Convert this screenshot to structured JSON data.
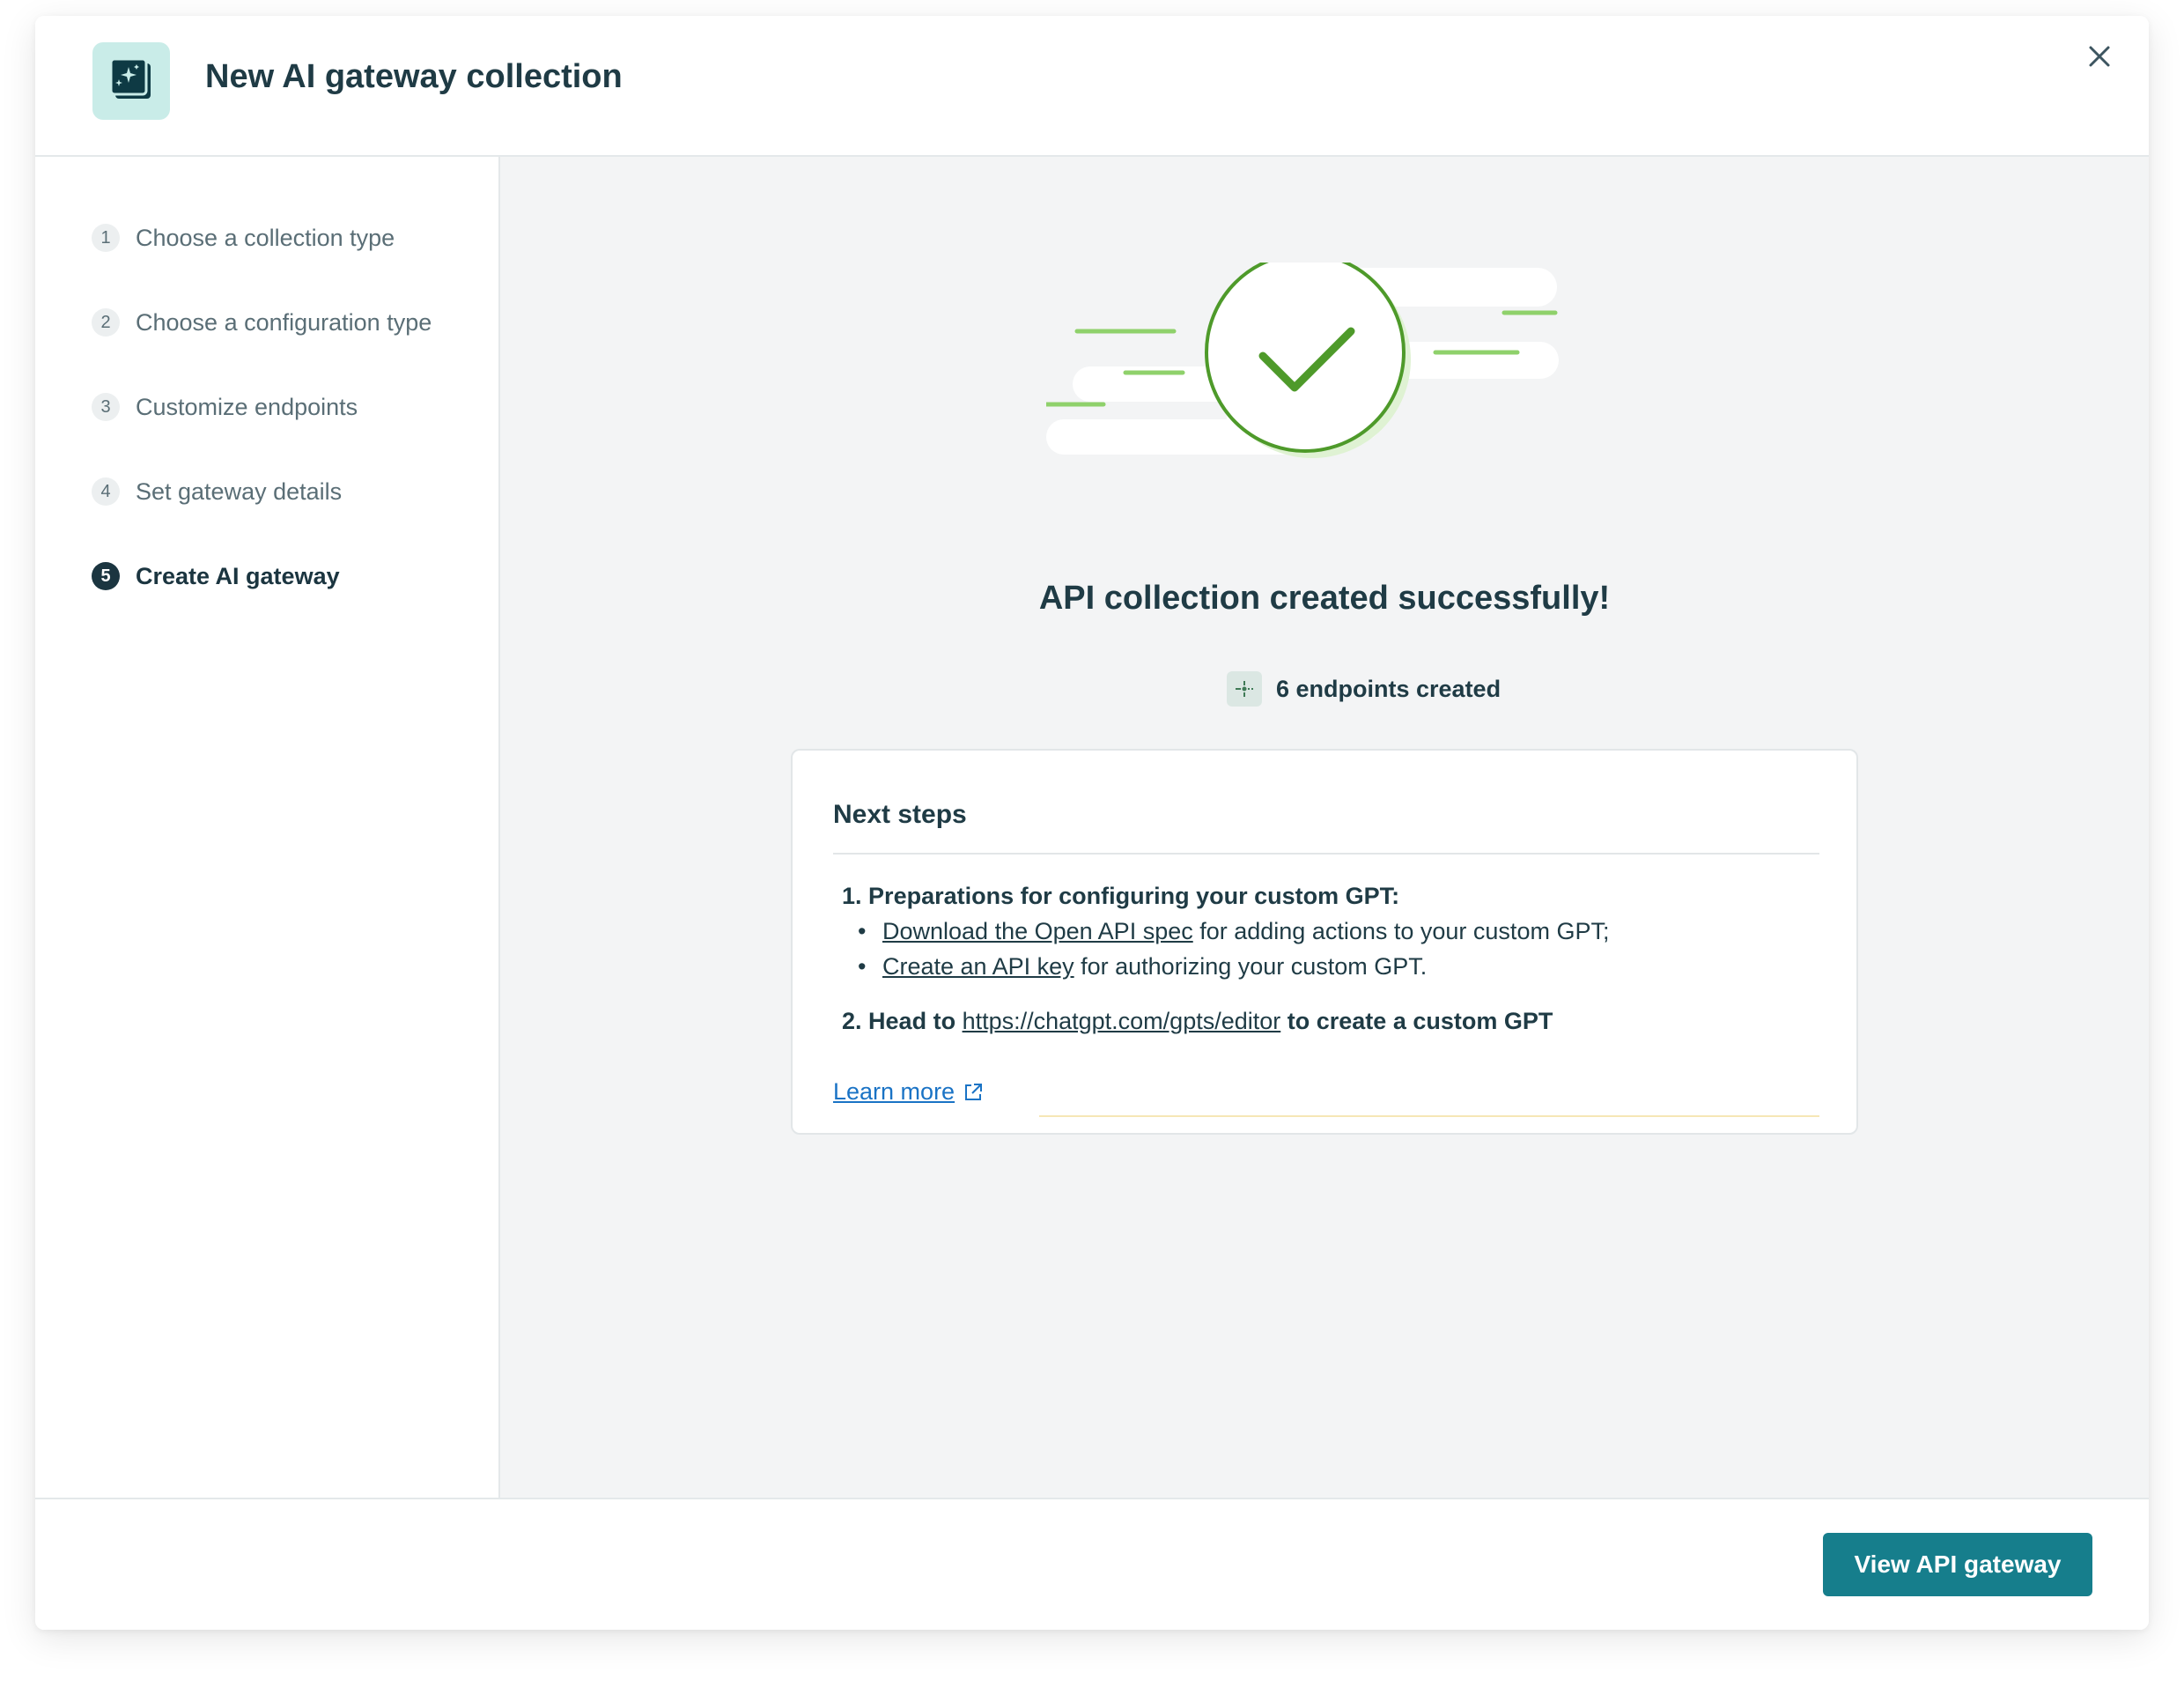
{
  "header": {
    "title": "New AI gateway collection",
    "icon": "ai-collection-icon"
  },
  "sidebar": {
    "steps": [
      {
        "number": "1",
        "label": "Choose a collection type"
      },
      {
        "number": "2",
        "label": "Choose a configuration type"
      },
      {
        "number": "3",
        "label": "Customize endpoints"
      },
      {
        "number": "4",
        "label": "Set gateway details"
      },
      {
        "number": "5",
        "label": "Create AI gateway"
      }
    ]
  },
  "main": {
    "success_title": "API collection created successfully!",
    "endpoints_text": "6 endpoints created",
    "next_steps": {
      "title": "Next steps",
      "item1": {
        "number": "1.",
        "heading": "Preparations for configuring your custom GPT:",
        "bullet1_link": "Download the Open API spec",
        "bullet1_rest": " for adding actions to your custom GPT;",
        "bullet2_link": "Create an API key",
        "bullet2_rest": " for authorizing your custom GPT."
      },
      "item2": {
        "number": "2.",
        "prefix": "Head to ",
        "link": "https://chatgpt.com/gpts/editor",
        "suffix": " to create a custom GPT"
      },
      "learn_more": "Learn more"
    }
  },
  "footer": {
    "primary_button": "View API gateway"
  },
  "colors": {
    "accent": "#167e8c",
    "success": "#4e9a2a",
    "link": "#1a73c5"
  }
}
